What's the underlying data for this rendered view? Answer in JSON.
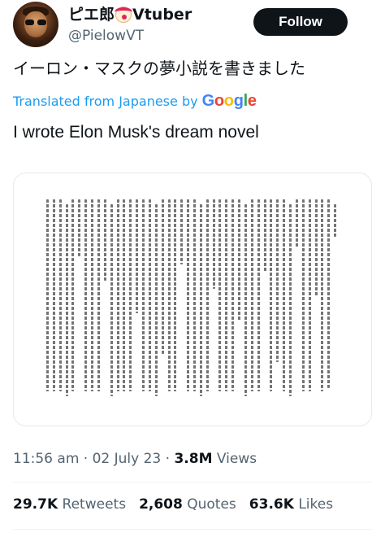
{
  "author": {
    "display_name_prefix": "ピエ郎",
    "display_name_suffix": "Vtuber",
    "display_name_emoji": "clown-face-icon",
    "handle": "@PielowVT"
  },
  "follow_button": {
    "label": "Follow"
  },
  "tweet": {
    "text": "イーロン・マスクの夢小説を書きました",
    "translated_label": "Translated from Japanese by",
    "translator": "Google",
    "translation": "I wrote Elon Musk's dream novel"
  },
  "media": {
    "icon": "manuscript-image"
  },
  "meta": {
    "time": "11:56 am",
    "date": "02 July 23",
    "views_count": "3.8M",
    "views_label": "Views"
  },
  "stats": {
    "retweets_count": "29.7K",
    "retweets_label": "Retweets",
    "quotes_count": "2,608",
    "quotes_label": "Quotes",
    "likes_count": "63.6K",
    "likes_label": "Likes"
  },
  "colors": {
    "accent": "#1d9bf0",
    "text": "#0f1419",
    "muted": "#536471",
    "follow_bg": "#0f1419"
  }
}
